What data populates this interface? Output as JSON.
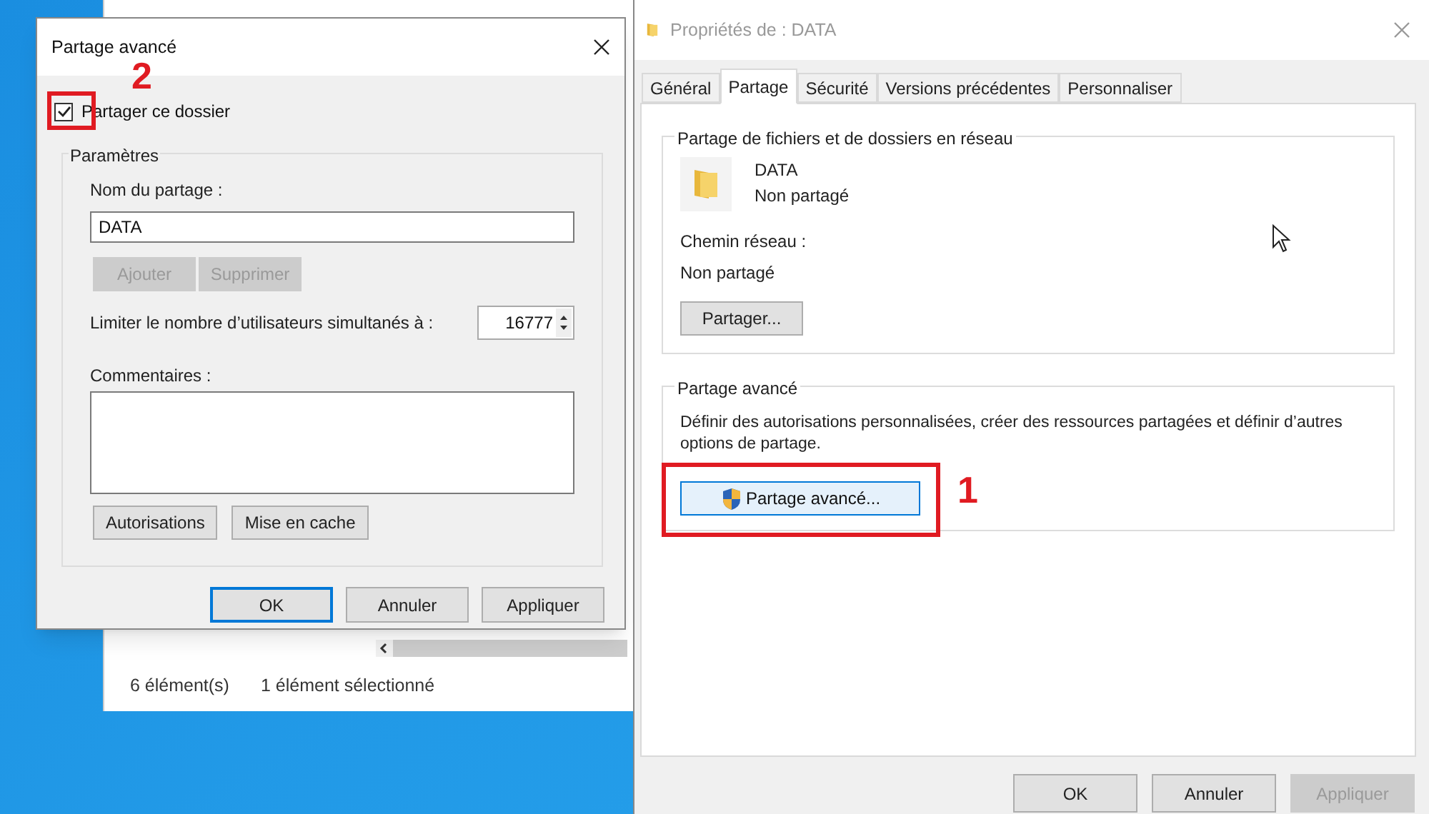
{
  "explorer_window": {
    "item_count": "6 élément(s)",
    "selection": "1 élément sélectionné"
  },
  "advanced_sharing_dialog": {
    "title": "Partage avancé",
    "share_checkbox": {
      "label": "Partager ce dossier",
      "checked": true
    },
    "settings_group": {
      "title": "Paramètres",
      "share_name_label": "Nom du partage :",
      "share_name_value": "DATA",
      "name_buttons": [
        {
          "label": "Ajouter",
          "disabled": true
        },
        {
          "label": "Supprimer",
          "disabled": true
        }
      ],
      "user_limit_label": "Limiter le nombre d’utilisateurs simultanés à :",
      "user_limit_value": "16777",
      "comments_label": "Commentaires :",
      "action_buttons": [
        {
          "label": "Autorisations",
          "disabled": false
        },
        {
          "label": "Mise en cache",
          "disabled": false
        }
      ]
    },
    "footer_buttons": [
      {
        "label": "OK",
        "default": true,
        "disabled": false
      },
      {
        "label": "Annuler",
        "default": false,
        "disabled": false
      },
      {
        "label": "Appliquer",
        "default": false,
        "disabled": false
      }
    ]
  },
  "properties_dialog": {
    "title": "Propriétés de : DATA",
    "tabs": [
      {
        "label": "Général",
        "selected": false
      },
      {
        "label": "Partage",
        "selected": true
      },
      {
        "label": "Sécurité",
        "selected": false
      },
      {
        "label": "Versions précédentes",
        "selected": false
      },
      {
        "label": "Personnaliser",
        "selected": false
      }
    ],
    "network_group": {
      "title": "Partage de fichiers et de dossiers en réseau",
      "folder_name": "DATA",
      "folder_status": "Non partagé",
      "path_label": "Chemin réseau :",
      "path_value": "Non partagé",
      "share_button": "Partager..."
    },
    "advanced_group": {
      "title": "Partage avancé",
      "description": "Définir des autorisations personnalisées, créer des ressources partagées et définir d’autres options de partage.",
      "button": "Partage avancé..."
    },
    "footer_buttons": [
      {
        "label": "OK",
        "default": false,
        "disabled": false
      },
      {
        "label": "Annuler",
        "default": false,
        "disabled": false
      },
      {
        "label": "Appliquer",
        "default": false,
        "disabled": true
      }
    ]
  },
  "annotations": [
    {
      "text": "2"
    },
    {
      "text": "1"
    }
  ]
}
